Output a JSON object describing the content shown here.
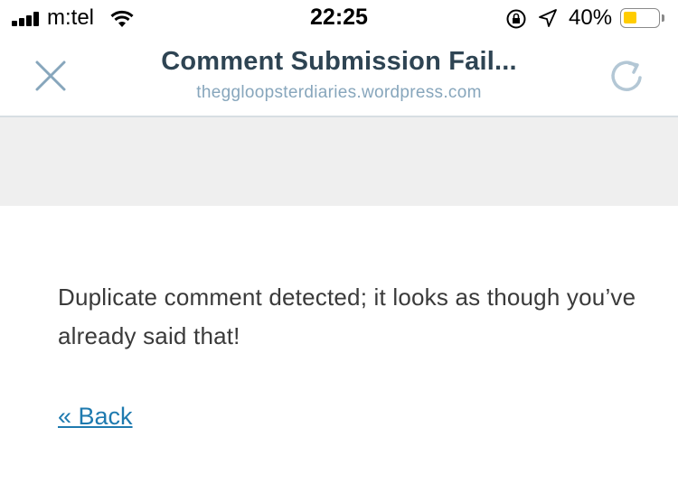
{
  "status_bar": {
    "carrier": "m:tel",
    "time": "22:25",
    "battery_percent": "40%",
    "battery_level": 0.4,
    "battery_color": "#ffcc00"
  },
  "header": {
    "title": "Comment Submission Fail...",
    "subtitle": "theggloopsterdiaries.wordpress.com",
    "close_icon": "close-icon",
    "reload_icon": "reload-icon"
  },
  "content": {
    "message": "Duplicate comment detected; it looks as though you’ve already said that!",
    "back_link": "« Back"
  },
  "colors": {
    "title": "#2e4453",
    "subtitle": "#87a6bc",
    "link": "#1e7aaf",
    "band": "#efefef"
  }
}
